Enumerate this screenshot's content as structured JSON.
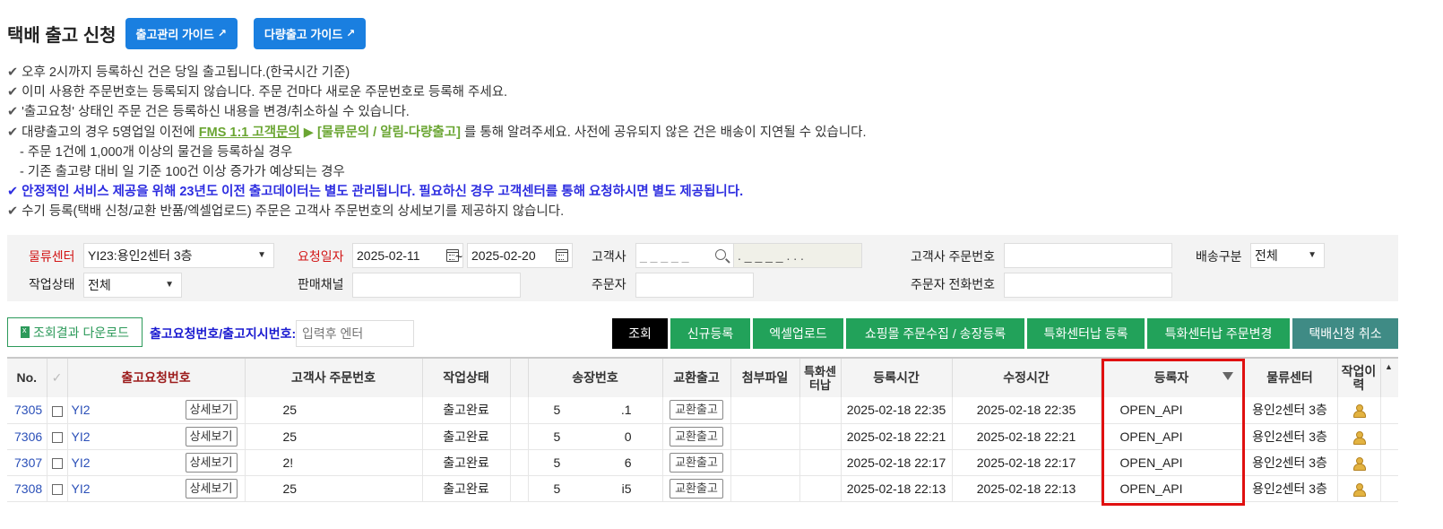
{
  "header": {
    "title": "택배 출고 신청",
    "guide_buttons": [
      {
        "label": "출고관리 가이드"
      },
      {
        "label": "다량출고 가이드"
      }
    ],
    "arrow_glyph": "↗"
  },
  "notices": {
    "check": "✔",
    "n1": "오후 2시까지 등록하신 건은 당일 출고됩니다.(한국시간 기준)",
    "n2": "이미 사용한 주문번호는 등록되지 않습니다. 주문 건마다 새로운 주문번호로 등록해 주세요.",
    "n3": "'출고요청' 상태인 주문 건은 등록하신 내용을 변경/취소하실 수 있습니다.",
    "n4_pre": "대량출고의 경우 5영업일 이전에 ",
    "n4_link": "FMS 1:1 고객문의",
    "n4_arrow": " ▶ ",
    "n4_category": "[물류문의 / 알림-다량출고]",
    "n4_post": " 를 통해 알려주세요. 사전에 공유되지 않은 건은 배송이 지연될 수 있습니다.",
    "n5": "- 주문 1건에 1,000개 이상의 물건을 등록하실 경우",
    "n6": "- 기존 출고량 대비 일 기준 100건 이상 증가가 예상되는 경우",
    "n7": "안정적인 서비스 제공을 위해 23년도 이전 출고데이터는 별도 관리됩니다. 필요하신 경우 고객센터를 통해 요청하시면 별도 제공됩니다.",
    "n8": "수기 등록(택배 신청/교환 반품/엑셀업로드) 주문은 고객사 주문번호의 상세보기를 제공하지 않습니다."
  },
  "filter": {
    "center_label": "물류센터",
    "center_value": "YI23:용인2센터 3층",
    "date_label": "요청일자",
    "date_from": "2025-02-11",
    "date_sep": "~",
    "date_to": "2025-02-20",
    "client_label": "고객사",
    "client_placeholder": "_ _ _ _ _",
    "client_name": ". _ _ _ _ . . .",
    "client_order_label": "고객사 주문번호",
    "delivery_label": "배송구분",
    "delivery_value": "전체",
    "status_label": "작업상태",
    "status_value": "전체",
    "channel_label": "판매채널",
    "orderer_label": "주문자",
    "orderer_phone_label": "주문자 전화번호",
    "caret": "▼"
  },
  "actions": {
    "download": "조회결과 다운로드",
    "req_label": "출고요청번호/출고지시번호:",
    "req_placeholder": "입력후 엔터",
    "buttons": [
      {
        "label": "조회",
        "color": "#000000"
      },
      {
        "label": "신규등록",
        "color": "#22a25a"
      },
      {
        "label": "엑셀업로드",
        "color": "#22a25a"
      },
      {
        "label": "쇼핑몰 주문수집 / 송장등록",
        "color": "#22a25a"
      },
      {
        "label": "특화센터납 등록",
        "color": "#22a25a"
      },
      {
        "label": "특화센터납 주문변경",
        "color": "#22a25a"
      },
      {
        "label": "택배신청 취소",
        "color": "#3f8b85"
      }
    ]
  },
  "table": {
    "headers": {
      "no": "No.",
      "check": "✓",
      "req_no": "출고요청번호",
      "client_order": "고객사 주문번호",
      "status": "작업상태",
      "tracking": "송장번호",
      "exchange": "교환출고",
      "attach": "첨부파일",
      "special": "특화센터납",
      "reg_time": "등록시간",
      "mod_time": "수정시간",
      "registrant": "등록자",
      "center": "물류센터",
      "history": "작업이력"
    },
    "detail_label": "상세보기",
    "exchange_label": "교환출고",
    "rows": [
      {
        "no": "7305",
        "req": "YI2",
        "client_order": "25",
        "status": "출고완료",
        "trk_a": "5",
        "trk_b": ".1",
        "reg": "2025-02-18 22:35",
        "mod": "2025-02-18 22:35",
        "registrant": "OPEN_API",
        "center": "용인2센터 3층"
      },
      {
        "no": "7306",
        "req": "YI2",
        "client_order": "25",
        "status": "출고완료",
        "trk_a": "5",
        "trk_b": "0",
        "reg": "2025-02-18 22:21",
        "mod": "2025-02-18 22:21",
        "registrant": "OPEN_API",
        "center": "용인2센터 3층"
      },
      {
        "no": "7307",
        "req": "YI2",
        "client_order": "2!",
        "status": "출고완료",
        "trk_a": "5",
        "trk_b": "6",
        "reg": "2025-02-18 22:17",
        "mod": "2025-02-18 22:17",
        "registrant": "OPEN_API",
        "center": "용인2센터 3층"
      },
      {
        "no": "7308",
        "req": "YI2",
        "client_order": "25",
        "status": "출고완료",
        "trk_a": "5",
        "trk_b": "i5",
        "reg": "2025-02-18 22:13",
        "mod": "2025-02-18 22:13",
        "registrant": "OPEN_API",
        "center": "용인2센터 3층"
      }
    ]
  },
  "colors": {
    "guide_blue": "#1a7fe0",
    "highlight_red": "#e01010",
    "notice_blue": "#2d2de0",
    "link_green": "#6aa532"
  }
}
